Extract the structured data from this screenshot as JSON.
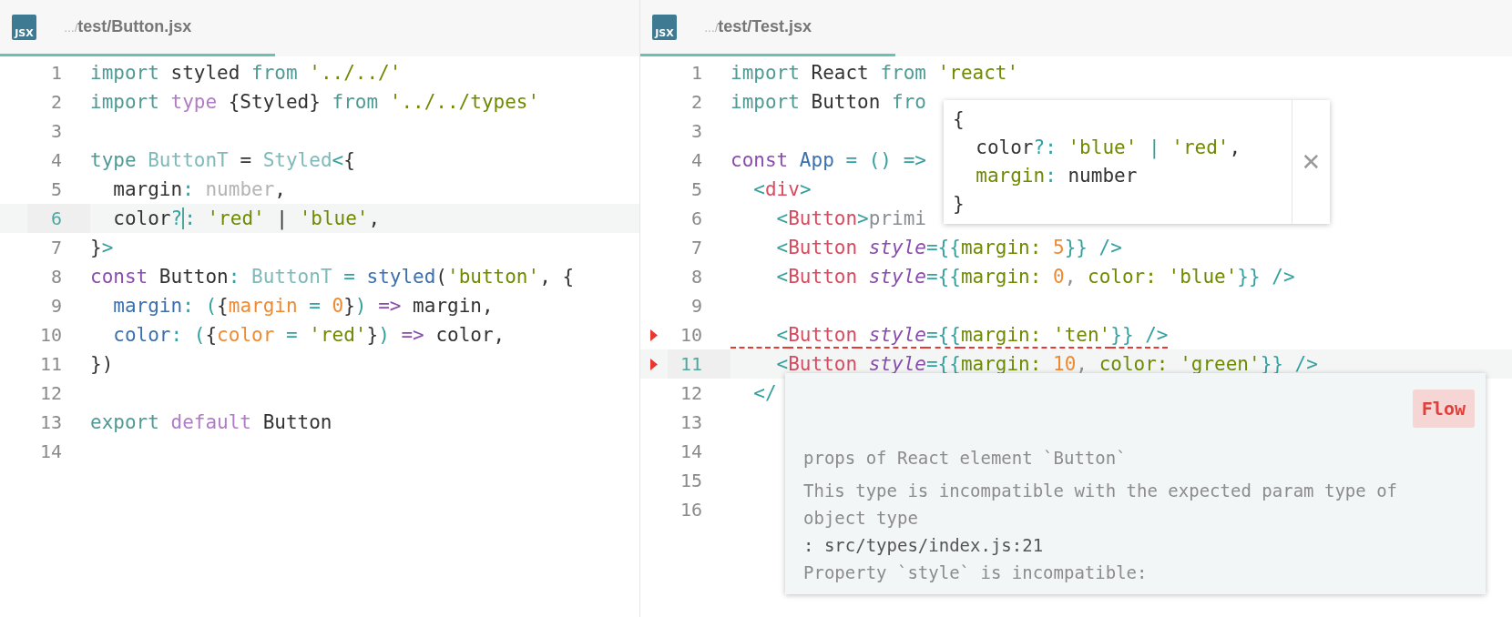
{
  "panes": [
    {
      "tab": {
        "icon": "JSX",
        "prefix": "…/",
        "path": "test/Button.jsx",
        "selected": true
      },
      "lines": [
        {
          "number": "1",
          "current": false,
          "error": false,
          "tokens": [
            {
              "kind": "keyword",
              "t": "import"
            },
            {
              "kind": "plain",
              "t": " styled "
            },
            {
              "kind": "keyword",
              "t": "from"
            },
            {
              "kind": "string",
              "t": " '../../'"
            }
          ]
        },
        {
          "number": "2",
          "current": false,
          "error": false,
          "tokens": [
            {
              "kind": "keyword",
              "t": "import"
            },
            {
              "kind": "keyword2",
              "t": " type"
            },
            {
              "kind": "plain",
              "t": " {Styled} "
            },
            {
              "kind": "keyword",
              "t": "from"
            },
            {
              "kind": "string",
              "t": " '../../types'"
            }
          ]
        },
        {
          "number": "3",
          "current": false,
          "error": false
        },
        {
          "number": "4",
          "current": false,
          "error": false,
          "tokens": [
            {
              "kind": "keyword",
              "t": "type"
            },
            {
              "kind": "type",
              "t": " ButtonT"
            },
            {
              "kind": "plain",
              "t": " = "
            },
            {
              "kind": "type",
              "t": "Styled"
            },
            {
              "kind": "punct",
              "t": "<"
            },
            {
              "kind": "plain",
              "t": "{"
            }
          ]
        },
        {
          "number": "5",
          "current": false,
          "error": false,
          "tokens": [
            {
              "kind": "plain",
              "t": "  margin"
            },
            {
              "kind": "punct",
              "t": ":"
            },
            {
              "kind": "hint",
              "t": " number"
            },
            {
              "kind": "plain",
              "t": ","
            }
          ]
        },
        {
          "number": "6",
          "current": true,
          "error": false,
          "tokens": [
            {
              "kind": "plain",
              "t": "  color"
            },
            {
              "kind": "punct",
              "t": "?",
              "caret": true
            },
            {
              "kind": "punct",
              "t": ":"
            },
            {
              "kind": "string",
              "t": " 'red'"
            },
            {
              "kind": "plain",
              "t": " | "
            },
            {
              "kind": "string",
              "t": "'blue'"
            },
            {
              "kind": "plain",
              "t": ","
            }
          ]
        },
        {
          "number": "7",
          "current": false,
          "error": false,
          "tokens": [
            {
              "kind": "plain",
              "t": "}"
            },
            {
              "kind": "punct",
              "t": ">"
            }
          ]
        },
        {
          "number": "8",
          "current": false,
          "error": false,
          "tokens": [
            {
              "kind": "keyword3",
              "t": "const"
            },
            {
              "kind": "plain",
              "t": " Button"
            },
            {
              "kind": "punct",
              "t": ":"
            },
            {
              "kind": "type",
              "t": " ButtonT"
            },
            {
              "kind": "punct",
              "t": " = "
            },
            {
              "kind": "func",
              "t": "styled"
            },
            {
              "kind": "plain",
              "t": "("
            },
            {
              "kind": "string",
              "t": "'button'"
            },
            {
              "kind": "plain",
              "t": ", {"
            }
          ]
        },
        {
          "number": "9",
          "current": false,
          "error": false,
          "tokens": [
            {
              "kind": "func",
              "t": "  margin"
            },
            {
              "kind": "punct",
              "t": ": ("
            },
            {
              "kind": "plain",
              "t": "{"
            },
            {
              "kind": "number",
              "t": "margin"
            },
            {
              "kind": "punct",
              "t": " = "
            },
            {
              "kind": "number",
              "t": "0"
            },
            {
              "kind": "plain",
              "t": "}"
            },
            {
              "kind": "punct",
              "t": ")"
            },
            {
              "kind": "keyword3",
              "t": " => "
            },
            {
              "kind": "plain",
              "t": "margin,"
            }
          ]
        },
        {
          "number": "10",
          "current": false,
          "error": false,
          "tokens": [
            {
              "kind": "func",
              "t": "  color"
            },
            {
              "kind": "punct",
              "t": ": ("
            },
            {
              "kind": "plain",
              "t": "{"
            },
            {
              "kind": "number",
              "t": "color"
            },
            {
              "kind": "punct",
              "t": " = "
            },
            {
              "kind": "string",
              "t": "'red'"
            },
            {
              "kind": "plain",
              "t": "}"
            },
            {
              "kind": "punct",
              "t": ")"
            },
            {
              "kind": "keyword3",
              "t": " => "
            },
            {
              "kind": "plain",
              "t": "color,"
            }
          ]
        },
        {
          "number": "11",
          "current": false,
          "error": false,
          "tokens": [
            {
              "kind": "plain",
              "t": "})"
            }
          ]
        },
        {
          "number": "12",
          "current": false,
          "error": false
        },
        {
          "number": "13",
          "current": false,
          "error": false,
          "tokens": [
            {
              "kind": "keyword",
              "t": "export"
            },
            {
              "kind": "keyword2",
              "t": " default"
            },
            {
              "kind": "plain",
              "t": " Button"
            }
          ]
        },
        {
          "number": "14",
          "current": false,
          "error": false
        }
      ]
    },
    {
      "tab": {
        "icon": "JSX",
        "prefix": "…/",
        "path": "test/Test.jsx",
        "selected": true
      },
      "lines": [
        {
          "number": "1",
          "current": false,
          "error": false,
          "tokens": [
            {
              "kind": "keyword",
              "t": "import"
            },
            {
              "kind": "plain",
              "t": " React "
            },
            {
              "kind": "keyword",
              "t": "from"
            },
            {
              "kind": "string",
              "t": " 'react'"
            }
          ]
        },
        {
          "number": "2",
          "current": false,
          "error": false,
          "tokens": [
            {
              "kind": "keyword",
              "t": "import"
            },
            {
              "kind": "plain",
              "t": " Button "
            },
            {
              "kind": "keyword",
              "t": "fro"
            }
          ]
        },
        {
          "number": "3",
          "current": false,
          "error": false
        },
        {
          "number": "4",
          "current": false,
          "error": false,
          "tokens": [
            {
              "kind": "keyword3",
              "t": "const"
            },
            {
              "kind": "func",
              "t": " App"
            },
            {
              "kind": "punct",
              "t": " = () =>"
            }
          ]
        },
        {
          "number": "5",
          "current": false,
          "error": false,
          "tokens": [
            {
              "kind": "punct",
              "t": "  <"
            },
            {
              "kind": "tag",
              "t": "div"
            },
            {
              "kind": "punct",
              "t": ">"
            }
          ]
        },
        {
          "number": "6",
          "current": false,
          "error": false,
          "tokens": [
            {
              "kind": "punct",
              "t": "    <"
            },
            {
              "kind": "tag",
              "t": "Button"
            },
            {
              "kind": "punct",
              "t": ">"
            },
            {
              "kind": "text",
              "t": "primi"
            }
          ]
        },
        {
          "number": "7",
          "current": false,
          "error": false,
          "tokens": [
            {
              "kind": "punct",
              "t": "    <"
            },
            {
              "kind": "tag",
              "t": "Button"
            },
            {
              "kind": "attr",
              "t": " style"
            },
            {
              "kind": "punct",
              "t": "={{"
            },
            {
              "kind": "string",
              "t": "margin: "
            },
            {
              "kind": "number",
              "t": "5"
            },
            {
              "kind": "punct",
              "t": "}} />"
            }
          ]
        },
        {
          "number": "8",
          "current": false,
          "error": false,
          "tokens": [
            {
              "kind": "punct",
              "t": "    <"
            },
            {
              "kind": "tag",
              "t": "Button"
            },
            {
              "kind": "attr",
              "t": " style"
            },
            {
              "kind": "punct",
              "t": "={{"
            },
            {
              "kind": "string",
              "t": "margin: "
            },
            {
              "kind": "number",
              "t": "0"
            },
            {
              "kind": "text",
              "t": ", "
            },
            {
              "kind": "string",
              "t": "color: 'blue'"
            },
            {
              "kind": "punct",
              "t": "}} />"
            }
          ]
        },
        {
          "number": "9",
          "current": false,
          "error": false
        },
        {
          "number": "10",
          "current": false,
          "error": true,
          "squiggle": true,
          "tokens": [
            {
              "kind": "punct",
              "t": "    <"
            },
            {
              "kind": "tag",
              "t": "Button"
            },
            {
              "kind": "attr",
              "t": " style"
            },
            {
              "kind": "punct",
              "t": "={{"
            },
            {
              "kind": "string",
              "t": "margin: 'ten'"
            },
            {
              "kind": "punct",
              "t": "}} />"
            }
          ]
        },
        {
          "number": "11",
          "current": true,
          "error": true,
          "tokens": [
            {
              "kind": "punct",
              "t": "    <"
            },
            {
              "kind": "tag",
              "t": "Button"
            },
            {
              "kind": "attr",
              "t": " style"
            },
            {
              "kind": "punct",
              "t": "={{"
            },
            {
              "kind": "string",
              "t": "margin: "
            },
            {
              "kind": "number",
              "t": "10"
            },
            {
              "kind": "text",
              "t": ", "
            },
            {
              "kind": "string",
              "t": "color: 'green'"
            },
            {
              "kind": "punct",
              "t": "}} />"
            }
          ]
        },
        {
          "number": "12",
          "current": false,
          "error": false,
          "tokens": [
            {
              "kind": "punct",
              "t": "  </"
            }
          ]
        },
        {
          "number": "13",
          "current": false,
          "error": false
        },
        {
          "number": "14",
          "current": false,
          "error": false
        },
        {
          "number": "15",
          "current": false,
          "error": false
        },
        {
          "number": "16",
          "current": false,
          "error": false
        }
      ]
    }
  ],
  "type_popup": {
    "lines": [
      [
        {
          "kind": "plain",
          "t": "{"
        }
      ],
      [
        {
          "kind": "plain",
          "t": "  color"
        },
        {
          "kind": "punct",
          "t": "?: "
        },
        {
          "kind": "string",
          "t": "'blue'"
        },
        {
          "kind": "punct",
          "t": " | "
        },
        {
          "kind": "string",
          "t": "'red'"
        },
        {
          "kind": "plain",
          "t": ","
        }
      ],
      [
        {
          "kind": "string",
          "t": "  margin"
        },
        {
          "kind": "punct",
          "t": ": "
        },
        {
          "kind": "plain",
          "t": "number"
        }
      ],
      [
        {
          "kind": "plain",
          "t": "}"
        }
      ]
    ],
    "close": "✕"
  },
  "error_popup": {
    "badge": "Flow",
    "messages": [
      {
        "kind": "title",
        "text": "props of React element `Button`"
      },
      {
        "kind": "detail",
        "text": "This type is incompatible with the expected param type of object type"
      },
      {
        "kind": "location",
        "text": ": src/types/index.js:21"
      },
      {
        "kind": "detail",
        "text": "Property `style` is incompatible:"
      }
    ]
  }
}
